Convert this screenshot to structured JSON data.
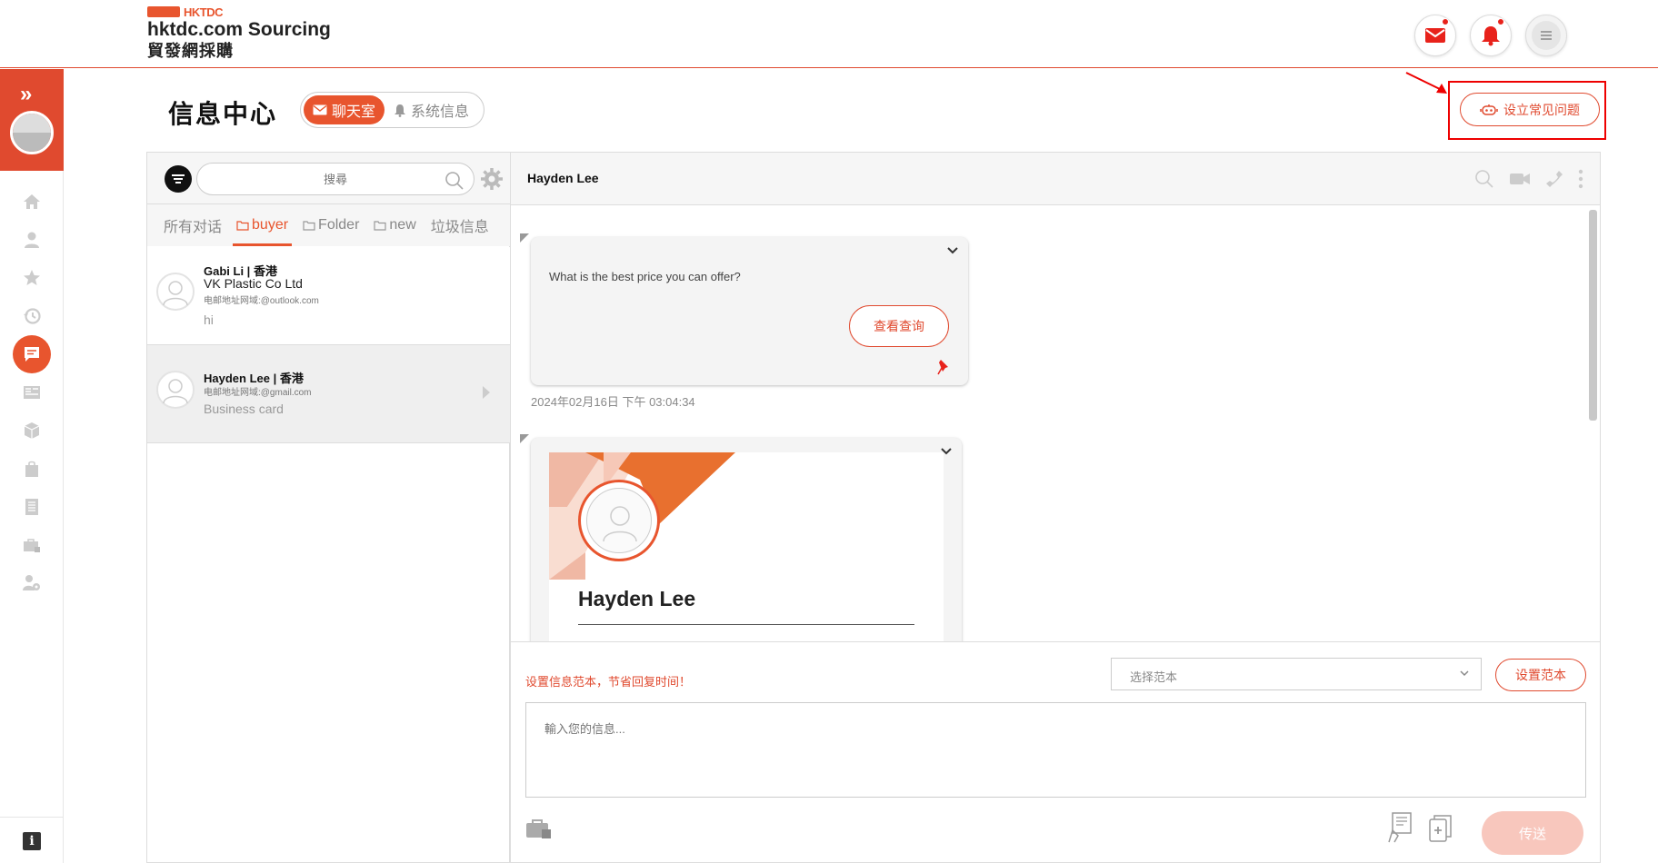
{
  "brand": {
    "small": "HKTDC",
    "name_en": "hktdc.com Sourcing",
    "name_zh": "貿發網採購"
  },
  "header_icons": [
    "mail-icon",
    "bell-icon",
    "menu-icon"
  ],
  "page": {
    "title": "信息中心",
    "tabs": [
      {
        "label": "聊天室",
        "active": true,
        "icon": "mail-icon"
      },
      {
        "label": "系统信息",
        "active": false,
        "icon": "bell-icon"
      }
    ],
    "faq_button": "设立常见问题"
  },
  "sidebar": {
    "items": [
      "home-icon",
      "user-icon",
      "star-icon",
      "history-icon",
      "chat-icon",
      "news-icon",
      "box-icon",
      "bag-icon",
      "list-icon",
      "briefcase-icon",
      "settings-user-icon"
    ],
    "active": "chat-icon",
    "footer_icon": "i"
  },
  "list": {
    "search_placeholder": "搜尋",
    "folders": [
      {
        "label": "所有对话",
        "icon": null,
        "active": false
      },
      {
        "label": "buyer",
        "icon": "folder-icon",
        "active": true
      },
      {
        "label": "Folder",
        "icon": "folder-icon",
        "active": false
      },
      {
        "label": "new",
        "icon": "folder-icon",
        "active": false
      },
      {
        "label": "垃圾信息",
        "icon": null,
        "active": false
      }
    ],
    "conversations": [
      {
        "name": "Gabi Li",
        "region": "香港",
        "company": "VK Plastic Co Ltd",
        "email": "电邮地址网域:@outlook.com",
        "last_message": "hi"
      },
      {
        "name": "Hayden Lee",
        "region": "香港",
        "company": "",
        "email": "电邮地址网域:@gmail.com",
        "last_message": "Business card"
      }
    ]
  },
  "chat": {
    "contact_name": "Hayden Lee",
    "messages": [
      {
        "text": "What is the best price you can offer?",
        "button": "查看查询",
        "timestamp": "2024年02月16日 下午 03:04:34"
      },
      {
        "card_name": "Hayden Lee"
      }
    ],
    "composer": {
      "template_hint": "设置信息范本，节省回复时间！",
      "template_select": "选择范本",
      "template_button": "设置范本",
      "input_placeholder": "輸入您的信息...",
      "send_label": "传送"
    }
  },
  "colors": {
    "accent": "#e8552e",
    "highlight_box": "#ee0000",
    "send_disabled": "#f8c7bd"
  }
}
